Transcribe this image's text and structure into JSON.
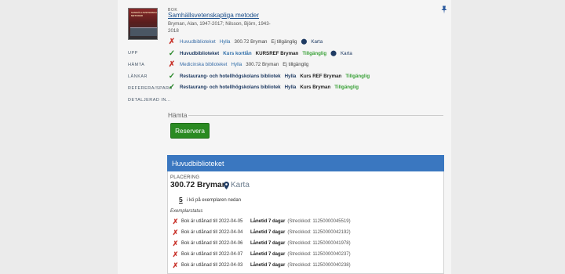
{
  "record": {
    "cover_text": "SAMHÄLLSVETENSKAPLIGA METODER",
    "type": "BOK",
    "title": "Samhällsvetenskapliga metoder",
    "author": "Bryman, Alan, 1947-2017; Nilsson, Björn, 1943-2018"
  },
  "sidenav": [
    "UPP",
    "HÄMTA",
    "LÄNKAR",
    "REFERERA/SPARA",
    "DETALJERAD IN..."
  ],
  "holdings": [
    {
      "available": false,
      "library": "Huvudbiblioteket",
      "loc_label": "Hylla",
      "callnumber": "300.72 Bryman",
      "status": "Ej tillgänglig",
      "map": "Karta"
    },
    {
      "available": true,
      "library": "Huvudbiblioteket",
      "loc_label": "Kurs kortlån",
      "callnumber": "KURSREF Bryman",
      "status": "Tillgänglig",
      "map": "Karta"
    },
    {
      "available": false,
      "library": "Medicinska biblioteket",
      "loc_label": "Hylla",
      "callnumber": "300.72 Bryman",
      "status": "Ej tillgänglig",
      "map": ""
    },
    {
      "available": true,
      "library": "Restaurang- och hotellhögskolans bibliotek",
      "loc_label": "Hylla",
      "callnumber": "Kurs REF Bryman",
      "status": "Tillgänglig",
      "map": ""
    },
    {
      "available": true,
      "library": "Restaurang- och hotellhögskolans bibliotek",
      "loc_label": "Hylla",
      "callnumber": "Kurs Bryman",
      "status": "Tillgänglig",
      "map": ""
    }
  ],
  "get": {
    "heading": "Hämta",
    "reserve_label": "Reservera"
  },
  "detail": {
    "header": "Huvudbiblioteket",
    "placement_label": "PLACERING",
    "placement_value": "300.72 Bryman",
    "map_label": "Karta",
    "queue_count": "5",
    "queue_text": "i kö på exemplaren nedan",
    "items_label": "Exemplarstatus",
    "items": [
      {
        "status": "Bok är utlånad till 2022-04-05",
        "loan": "Lånetid 7 dagar",
        "barcode": "(Streckkod: 11250000045519)"
      },
      {
        "status": "Bok är utlånad till 2022-04-04",
        "loan": "Lånetid 7 dagar",
        "barcode": "(Streckkod: 11250000042192)"
      },
      {
        "status": "Bok är utlånad till 2022-04-06",
        "loan": "Lånetid 7 dagar",
        "barcode": "(Streckkod: 11250000041978)"
      },
      {
        "status": "Bok är utlånad till 2022-04-07",
        "loan": "Lånetid 7 dagar",
        "barcode": "(Streckkod: 11250000040237)"
      },
      {
        "status": "Bok är utlånad till 2022-04-03",
        "loan": "Lånetid 7 dagar",
        "barcode": "(Streckkod: 11250000040238)"
      }
    ]
  },
  "colors": {
    "link": "#1b4f8c",
    "available": "#3aa138",
    "unavailable": "#c9342c",
    "header": "#3a77c0",
    "button": "#2a8a22"
  }
}
